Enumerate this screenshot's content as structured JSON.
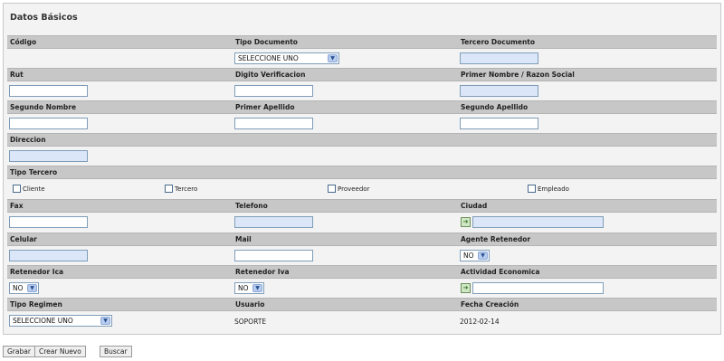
{
  "title": "Datos Básicos",
  "labels": {
    "codigo": "Código",
    "tipo_documento": "Tipo Documento",
    "tercero_documento": "Tercero Documento",
    "rut": "Rut",
    "digito_verificacion": "Digito Verificacion",
    "primer_nombre": "Primer Nombre / Razon Social",
    "segundo_nombre": "Segundo Nombre",
    "primer_apellido": "Primer Apellido",
    "segundo_apellido": "Segundo Apellido",
    "direccion": "Direccion",
    "tipo_tercero": "Tipo Tercero",
    "fax": "Fax",
    "telefono": "Telefono",
    "ciudad": "Ciudad",
    "celular": "Celular",
    "mail": "Mail",
    "agente_retenedor": "Agente Retenedor",
    "retenedor_ica": "Retenedor Ica",
    "retenedor_iva": "Retenedor Iva",
    "actividad_economica": "Actividad Economica",
    "tipo_regimen": "Tipo Regimen",
    "usuario": "Usuario",
    "fecha_creacion": "Fecha Creación"
  },
  "selects": {
    "tipo_documento": "SELECCIONE UNO",
    "agente_retenedor": "NO",
    "retenedor_ica": "NO",
    "retenedor_iva": "NO",
    "tipo_regimen": "SELECCIONE UNO"
  },
  "checkboxes": {
    "cliente": "Cliente",
    "tercero": "Tercero",
    "proveedor": "Proveedor",
    "empleado": "Empleado"
  },
  "values": {
    "usuario": "SOPORTE",
    "fecha_creacion": "2012-02-14"
  },
  "icons": {
    "lookup": "search-lookup-icon",
    "dropdown": "chevron-down-icon"
  },
  "buttons": {
    "grabar": "Grabar",
    "crear_nuevo": "Crear Nuevo",
    "buscar": "Buscar"
  },
  "colors": {
    "header_bg": "#c7c7c7",
    "panel_bg": "#f3f3f3",
    "readonly_field_bg": "#dbe7f8"
  }
}
